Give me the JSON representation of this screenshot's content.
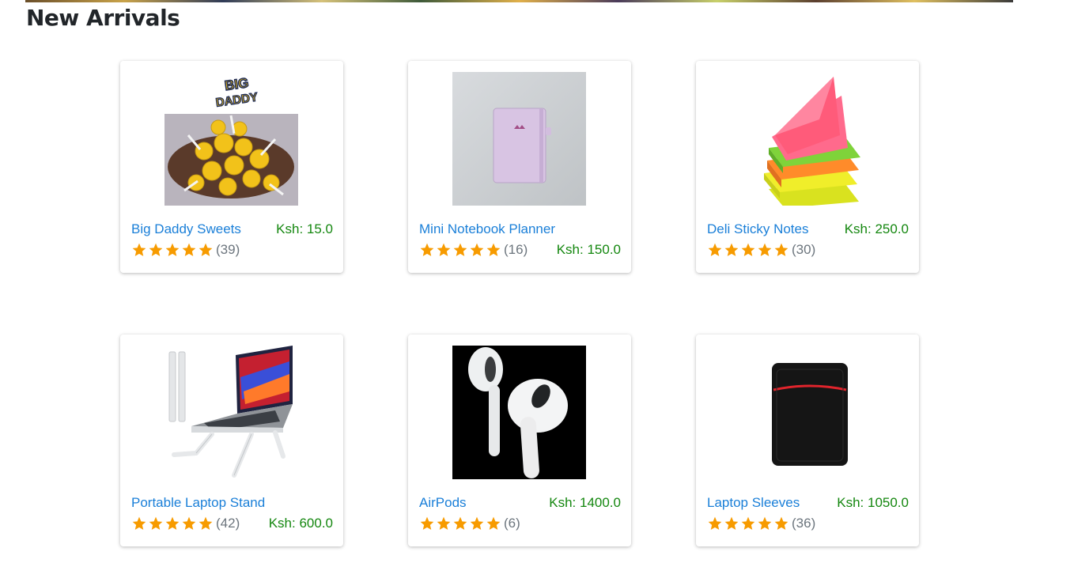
{
  "section": {
    "title": "New Arrivals"
  },
  "colors": {
    "link": "#1a7fd8",
    "price": "#14870f",
    "star": "#f79b00",
    "muted": "#6c757d"
  },
  "products": [
    {
      "name": "Big Daddy Sweets",
      "price": "Ksh: 15.0",
      "rating_count": "(39)",
      "stars": 5,
      "image_icon": "lollipops-image",
      "logo_text": "BIG DADDY"
    },
    {
      "name": "Mini Notebook Planner",
      "price": "Ksh: 150.0",
      "rating_count": "(16)",
      "stars": 5,
      "image_icon": "notebook-image"
    },
    {
      "name": "Deli Sticky Notes",
      "price": "Ksh: 250.0",
      "rating_count": "(30)",
      "stars": 5,
      "image_icon": "sticky-notes-image"
    },
    {
      "name": "Portable Laptop Stand",
      "price": "Ksh: 600.0",
      "rating_count": "(42)",
      "stars": 5,
      "image_icon": "laptop-stand-image"
    },
    {
      "name": "AirPods",
      "price": "Ksh: 1400.0",
      "rating_count": "(6)",
      "stars": 5,
      "image_icon": "airpods-image"
    },
    {
      "name": "Laptop Sleeves",
      "price": "Ksh: 1050.0",
      "rating_count": "(36)",
      "stars": 5,
      "image_icon": "laptop-sleeve-image"
    }
  ]
}
